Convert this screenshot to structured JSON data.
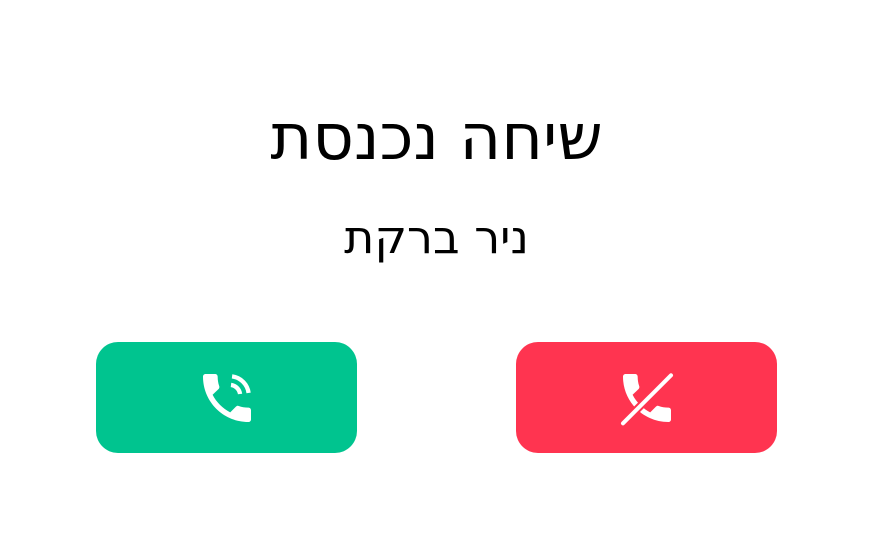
{
  "call": {
    "title": "שיחה נכנסת",
    "caller_name": "ניר ברקת"
  },
  "buttons": {
    "accept": {
      "icon": "phone-ringing-icon",
      "color": "#00C48F"
    },
    "decline": {
      "icon": "phone-hangup-icon",
      "color": "#FF3450"
    }
  },
  "colors": {
    "background": "#FFFFFF",
    "text": "#000000",
    "icon": "#FFFFFF"
  }
}
